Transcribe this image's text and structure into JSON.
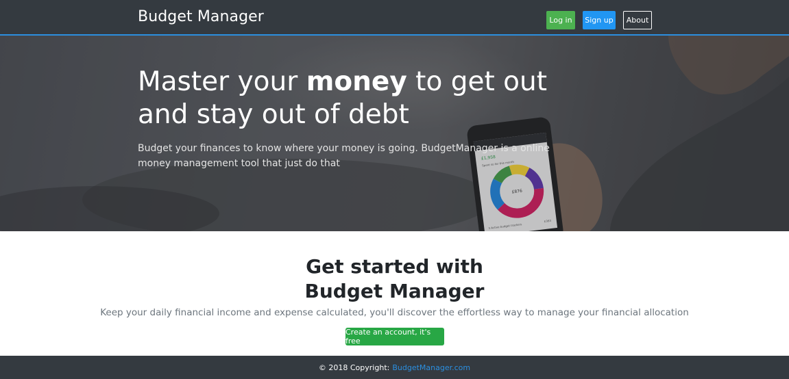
{
  "navbar": {
    "brand": "Budget Manager",
    "login_label": "Log in",
    "signup_label": "Sign up",
    "about_label": "About"
  },
  "hero": {
    "title_part1": "Master your ",
    "title_bold": "money",
    "title_part2": " to get out and stay out of debt",
    "text": "Budget your finances to know where your money is going. BudgetManager is a online money management tool that just do that",
    "phone": {
      "amount_top": "£1,958",
      "header": "Spent so far this month",
      "center": "£876",
      "footer": "3 Active budget trackers",
      "footer_right": "£363"
    }
  },
  "cta": {
    "title_line1": "Get started with",
    "title_line2": "Budget Manager",
    "subtitle": "Keep your daily financial income and expense calculated, you'll discover the effortless way to manage your financial allocation",
    "button_label": "Create an account, it's free"
  },
  "footer": {
    "copyright": "© 2018 Copyright:",
    "link_text": "BudgetManager.com"
  },
  "colors": {
    "navbar": "#343a40",
    "accent_blue": "#2196f3",
    "login_green": "#4cb150",
    "cta_green": "#28a745"
  }
}
